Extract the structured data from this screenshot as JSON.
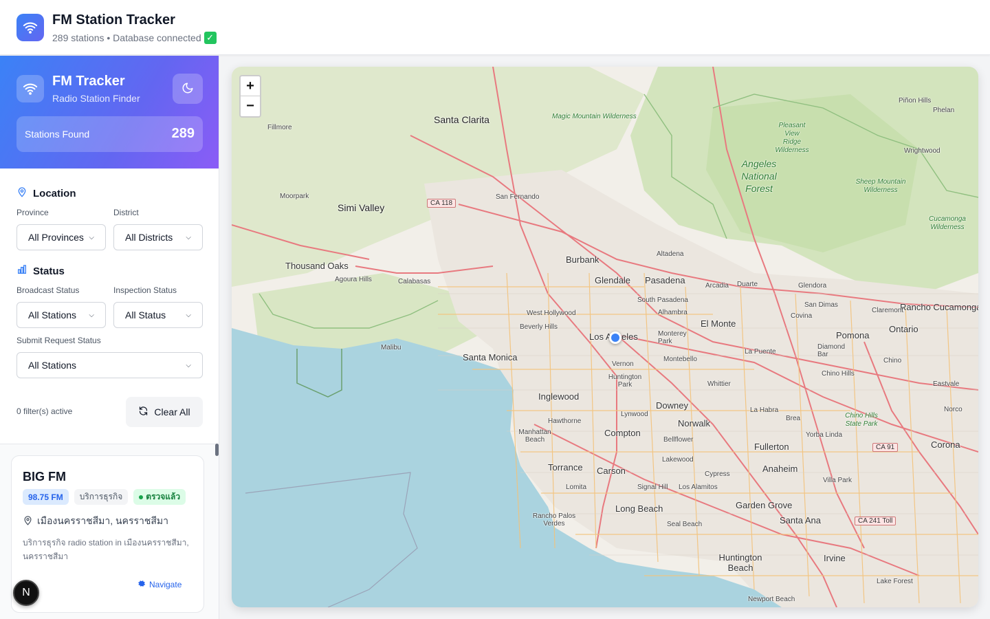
{
  "header": {
    "title": "FM Station Tracker",
    "subtitle": "289 stations • Database connected",
    "status_icon": "✓"
  },
  "sidebar": {
    "brand_title": "FM Tracker",
    "brand_subtitle": "Radio Station Finder",
    "stations_found_label": "Stations Found",
    "stations_found_count": "289",
    "location_heading": "Location",
    "province_label": "Province",
    "province_value": "All Provinces",
    "district_label": "District",
    "district_value": "All Districts",
    "status_heading": "Status",
    "broadcast_label": "Broadcast Status",
    "broadcast_value": "All Stations",
    "inspection_label": "Inspection Status",
    "inspection_value": "All Status",
    "submit_label": "Submit Request Status",
    "submit_value": "All Stations",
    "filters_active": "0 filter(s) active",
    "clear_all": "Clear All"
  },
  "station_card": {
    "name": "BIG FM",
    "frequency": "98.75 FM",
    "type": "บริการธุรกิจ",
    "status": "ตรวจแล้ว",
    "location": "เมืองนครราชสีมา, นครราชสีมา",
    "description": "บริการธุรกิจ radio station in เมืองนครราชสีมา, นครราชสีมา",
    "navigate": "Navigate"
  },
  "dev_badge": "N",
  "map": {
    "zoom_in": "+",
    "zoom_out": "−",
    "places": [
      "Santa Clarita",
      "Fillmore",
      "Magic Mountain Wilderness",
      "Pleasant View Ridge Wilderness",
      "Piñon Hills",
      "Phelan",
      "Wrightwood",
      "Angeles National Forest",
      "Sheep Mountain Wilderness",
      "Cucamonga Wilderness",
      "Moorpark",
      "Simi Valley",
      "CA 118",
      "San Fernando",
      "Burbank",
      "Thousand Oaks",
      "Agoura Hills",
      "Calabasas",
      "Altadena",
      "Glendale",
      "Pasadena",
      "Arcadia",
      "Duarte",
      "Glendora",
      "South Pasadena",
      "San Dimas",
      "Rancho Cucamonga",
      "West Hollywood",
      "Alhambra",
      "El Monte",
      "Covina",
      "Claremont",
      "Beverly Hills",
      "Los Angeles",
      "Monterey Park",
      "Pomona",
      "Ontario",
      "Malibu",
      "Santa Monica",
      "Montebello",
      "La Puente",
      "Diamond Bar",
      "Chino",
      "Vernon",
      "Huntington Park",
      "Whittier",
      "Chino Hills",
      "Eastvale",
      "Inglewood",
      "Downey",
      "La Habra",
      "Brea",
      "Norco",
      "Hawthorne",
      "Lynwood",
      "Norwalk",
      "Chino Hills State Park",
      "Manhattan Beach",
      "Compton",
      "Bellflower",
      "Yorba Linda",
      "Fullerton",
      "CA 91",
      "Corona",
      "Torrance",
      "Carson",
      "Lakewood",
      "Anaheim",
      "Cypress",
      "Villa Park",
      "Lomita",
      "Signal Hill",
      "Los Alamitos",
      "Rancho Palos Verdes",
      "Long Beach",
      "Garden Grove",
      "Seal Beach",
      "Santa Ana",
      "CA 241 Toll",
      "Huntington Beach",
      "Irvine",
      "Lake Forest",
      "Newport Beach"
    ]
  }
}
